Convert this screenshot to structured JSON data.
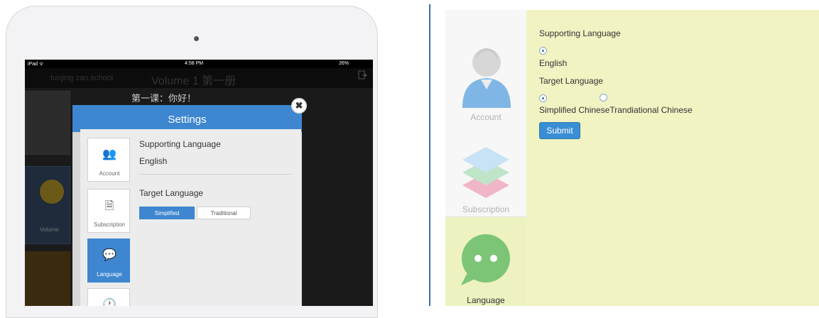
{
  "ipad": {
    "status": {
      "carrier": "iPad ᯤ",
      "time": "4:58 PM",
      "battery": "26%"
    },
    "header": {
      "school": "tuojing zan.school",
      "volume": "Volume 1 第一册",
      "logout_label": "Logout"
    },
    "lesson_title": "第一课：你好！",
    "volume_label": "Volume",
    "settings": {
      "title": "Settings",
      "close_label": "✖",
      "tabs": [
        {
          "label": "Account",
          "icon": "users-icon",
          "glyph": "👥"
        },
        {
          "label": "Subscription",
          "icon": "document-icon",
          "glyph": "🗎"
        },
        {
          "label": "Language",
          "icon": "chat-bubble-icon",
          "glyph": "💬"
        },
        {
          "label": "",
          "icon": "clock-icon",
          "glyph": "🕐"
        }
      ],
      "supporting_language_label": "Supporting Language",
      "supporting_language_value": "English",
      "target_language_label": "Target Language",
      "target_options": [
        "Simplified",
        "Traditional"
      ],
      "target_selected": "Simplified"
    }
  },
  "web": {
    "sidebar": [
      {
        "label": "Account",
        "icon": "avatar-icon"
      },
      {
        "label": "Subscription",
        "icon": "layers-icon"
      },
      {
        "label": "Language",
        "icon": "chat-bubble-icon"
      }
    ],
    "active_tab": "Language",
    "supporting_language_label": "Supporting Language",
    "supporting_option": "English",
    "target_language_label": "Target Language",
    "target_options_text": "Simplified ChineseTrandiational Chinese",
    "target_options": [
      "Simplified Chinese",
      "Trandiational Chinese"
    ],
    "target_selected": "Simplified Chinese",
    "submit_label": "Submit"
  },
  "colors": {
    "accent": "#3e86cf",
    "panel": "#f1f3c3",
    "sidebar": "#f7f7f7"
  }
}
